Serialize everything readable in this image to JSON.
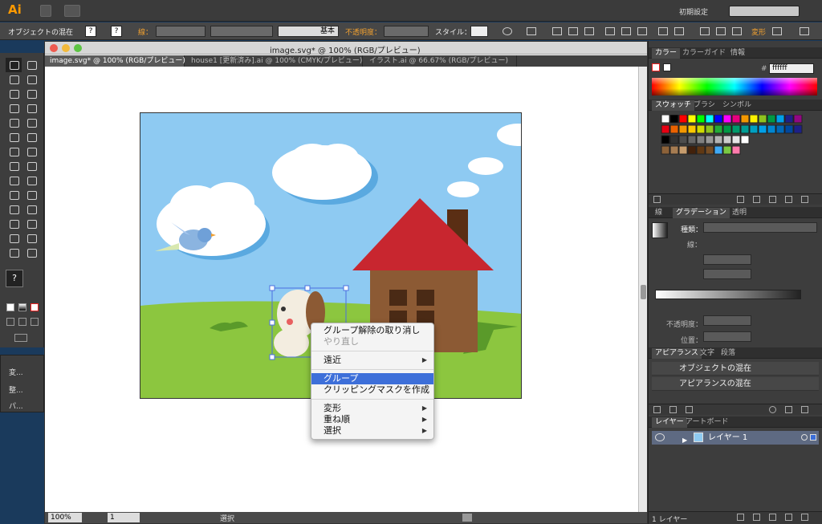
{
  "app": {
    "logo": "Ai",
    "workspace": "初期設定"
  },
  "control_bar": {
    "selection_label": "オブジェクトの混在",
    "stroke_label": "線：",
    "brush_value": "基本",
    "opacity_label": "不透明度：",
    "style_label": "スタイル：",
    "transform_label": "変形",
    "q1": "?",
    "q2": "?"
  },
  "tools": {
    "fill_stroke": "?",
    "sub_panel": [
      "変...",
      "整...",
      "パ..."
    ]
  },
  "document": {
    "title": "image.svg* @ 100% (RGB/プレビュー)",
    "tabs": [
      "image.svg* @ 100% (RGB/プレビュー)",
      "house1 [更新済み].ai @ 100% (CMYK/プレビュー)",
      "イラスト.ai @ 66.67% (RGB/プレビュー)"
    ],
    "status": {
      "zoom": "100%",
      "page": "1",
      "tool": "選択"
    }
  },
  "context_menu": {
    "items": [
      {
        "label": "グループ解除の取り消し",
        "disabled": false,
        "submenu": false
      },
      {
        "label": "やり直し",
        "disabled": true,
        "submenu": false
      },
      {
        "label": "遠近",
        "disabled": false,
        "submenu": true
      },
      {
        "label": "グループ",
        "disabled": false,
        "submenu": false,
        "highlighted": true
      },
      {
        "label": "クリッピングマスクを作成",
        "disabled": false,
        "submenu": false
      },
      {
        "label": "変形",
        "disabled": false,
        "submenu": true
      },
      {
        "label": "重ね順",
        "disabled": false,
        "submenu": true
      },
      {
        "label": "選択",
        "disabled": false,
        "submenu": true
      }
    ]
  },
  "panels": {
    "color": {
      "tabs": [
        "カラー",
        "カラーガイド",
        "情報"
      ],
      "hex": "ffffff",
      "hash": "#"
    },
    "swatches": {
      "tabs": [
        "スウォッチ",
        "ブラシ",
        "シンボル"
      ]
    },
    "gradient": {
      "tabs": [
        "線",
        "グラデーション",
        "透明"
      ],
      "type_label": "種類：",
      "stroke_label": "線：",
      "opacity_label": "不透明度：",
      "position_label": "位置："
    },
    "appearance": {
      "tabs": [
        "アピアランス",
        "文字",
        "段落"
      ],
      "rows": [
        "オブジェクトの混在",
        "アピアランスの混在"
      ]
    },
    "layers": {
      "tabs": [
        "レイヤー",
        "アートボード"
      ],
      "layer_name": "レイヤー 1",
      "count": "1 レイヤー"
    }
  },
  "colors": {
    "sky": "#8ecaf2",
    "grass": "#8cc63f",
    "roof": "#c8262f",
    "house": "#8c5a34",
    "window": "#4a2a15",
    "accent_orange": "#f0a030",
    "menu_highlight": "#3d6fd9"
  }
}
